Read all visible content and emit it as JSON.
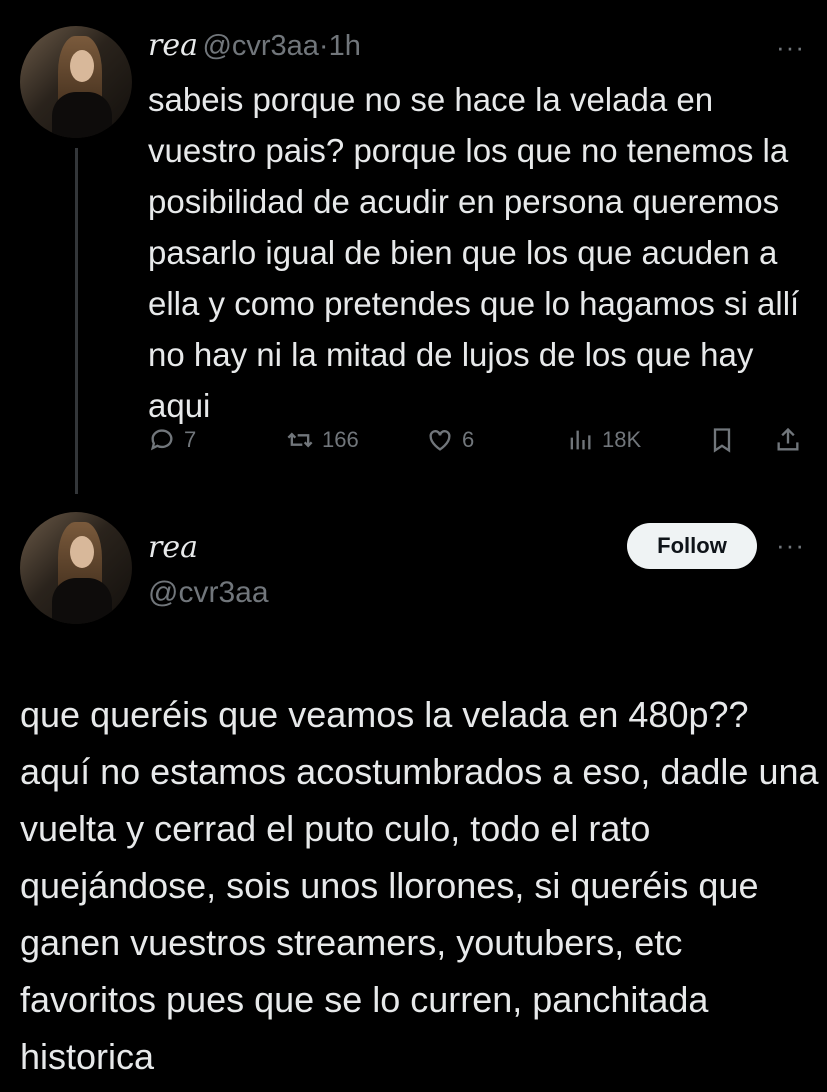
{
  "reply_tweet": {
    "author_name": "rea",
    "author_handle": "@cvr3aa",
    "separator": "·",
    "time": "1h",
    "more_label": "···",
    "text": "sabeis porque no se hace la velada en vuestro pais? porque los que no tenemos la posibilidad de acudir en persona queremos pasarlo igual de bien que los que acuden a ella y como pretendes que lo hagamos si allí no hay ni la mitad de lujos de los que hay aqui",
    "stats": {
      "replies": "7",
      "retweets": "166",
      "likes": "6",
      "views": "18K"
    }
  },
  "main_tweet": {
    "author_name": "rea",
    "author_handle": "@cvr3aa",
    "follow_label": "Follow",
    "more_label": "···",
    "text": "que queréis que veamos la velada en 480p?? aquí no estamos acostumbrados a eso, dadle una vuelta y cerrad el puto culo, todo el rato quejándose, sois unos llorones, si queréis que ganen vuestros streamers, youtubers, etc favoritos pues que se lo curren, panchitada historica"
  },
  "icons": [
    "reply-icon",
    "retweet-icon",
    "like-icon",
    "views-icon",
    "bookmark-icon",
    "share-icon",
    "more-icon"
  ]
}
